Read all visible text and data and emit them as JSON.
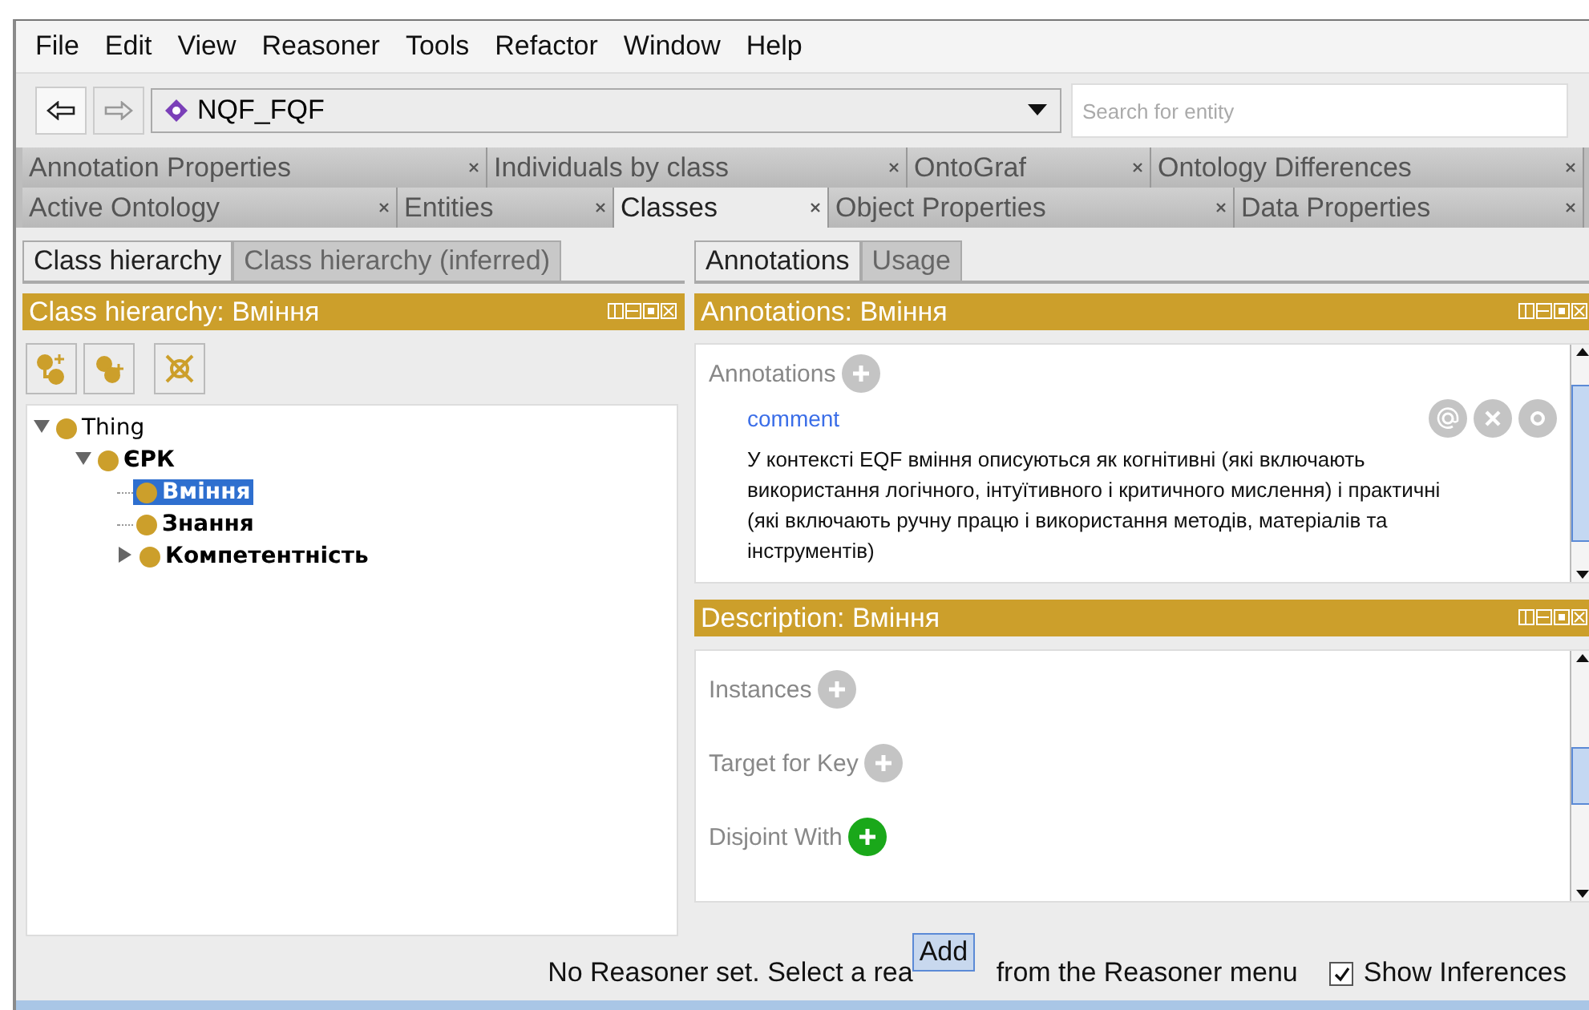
{
  "menu": [
    {
      "label": "File"
    },
    {
      "label": "Edit"
    },
    {
      "label": "View"
    },
    {
      "label": "Reasoner"
    },
    {
      "label": "Tools"
    },
    {
      "label": "Refactor"
    },
    {
      "label": "Window"
    },
    {
      "label": "Help"
    }
  ],
  "toolbar": {
    "ontology": "NQF_FQF",
    "search": {
      "placeholder": "Search for entity"
    }
  },
  "tab_rows": [
    [
      {
        "label": "Annotation Properties",
        "selected": false
      },
      {
        "label": "Individuals by class",
        "selected": false
      },
      {
        "label": "OntoGraf",
        "selected": false
      },
      {
        "label": "Ontology Differences",
        "selected": false
      }
    ],
    [
      {
        "label": "Active Ontology",
        "selected": false
      },
      {
        "label": "Entities",
        "selected": false
      },
      {
        "label": "Classes",
        "selected": true
      },
      {
        "label": "Object Properties",
        "selected": false
      },
      {
        "label": "Data Properties",
        "selected": false
      }
    ]
  ],
  "left": {
    "tabs": [
      {
        "label": "Class hierarchy",
        "selected": true
      },
      {
        "label": "Class hierarchy (inferred)",
        "selected": false
      }
    ],
    "header": "Class hierarchy: Вміння",
    "tree": [
      {
        "label": "Thing",
        "bold": false,
        "selected": false,
        "expanded": true,
        "children": [
          {
            "label": "ЄРК",
            "bold": true,
            "selected": false,
            "expanded": true,
            "children": [
              {
                "label": "Вміння",
                "bold": true,
                "selected": true
              },
              {
                "label": "Знання",
                "bold": true,
                "selected": false
              },
              {
                "label": "Компетентність",
                "bold": true,
                "selected": false,
                "expanded": false
              }
            ]
          }
        ]
      }
    ]
  },
  "right": {
    "tabs": [
      {
        "label": "Annotations",
        "selected": true
      },
      {
        "label": "Usage",
        "selected": false
      }
    ],
    "annotations": {
      "header": "Annotations: Вміння",
      "section": "Annotations",
      "items": [
        {
          "property": "comment",
          "value": "У контексті EQF вміння описуються як когнітивні (які включають використання логічного, інтуїтивного і критичного мислення) і практичні (які включають ручну працю і використання методів, матеріалів та інструментів)"
        }
      ]
    },
    "description": {
      "header": "Description: Вміння",
      "sections": [
        {
          "label": "Instances",
          "highlighted": false
        },
        {
          "label": "Target for Key",
          "highlighted": false
        },
        {
          "label": "Disjoint With",
          "highlighted": true
        }
      ]
    }
  },
  "status_bar": {
    "text_before": "No Reasoner set. Select a rea",
    "tooltip": "Add",
    "text_after": "from the Reasoner menu",
    "show_inferences": {
      "label": "Show Inferences",
      "checked": true
    }
  }
}
